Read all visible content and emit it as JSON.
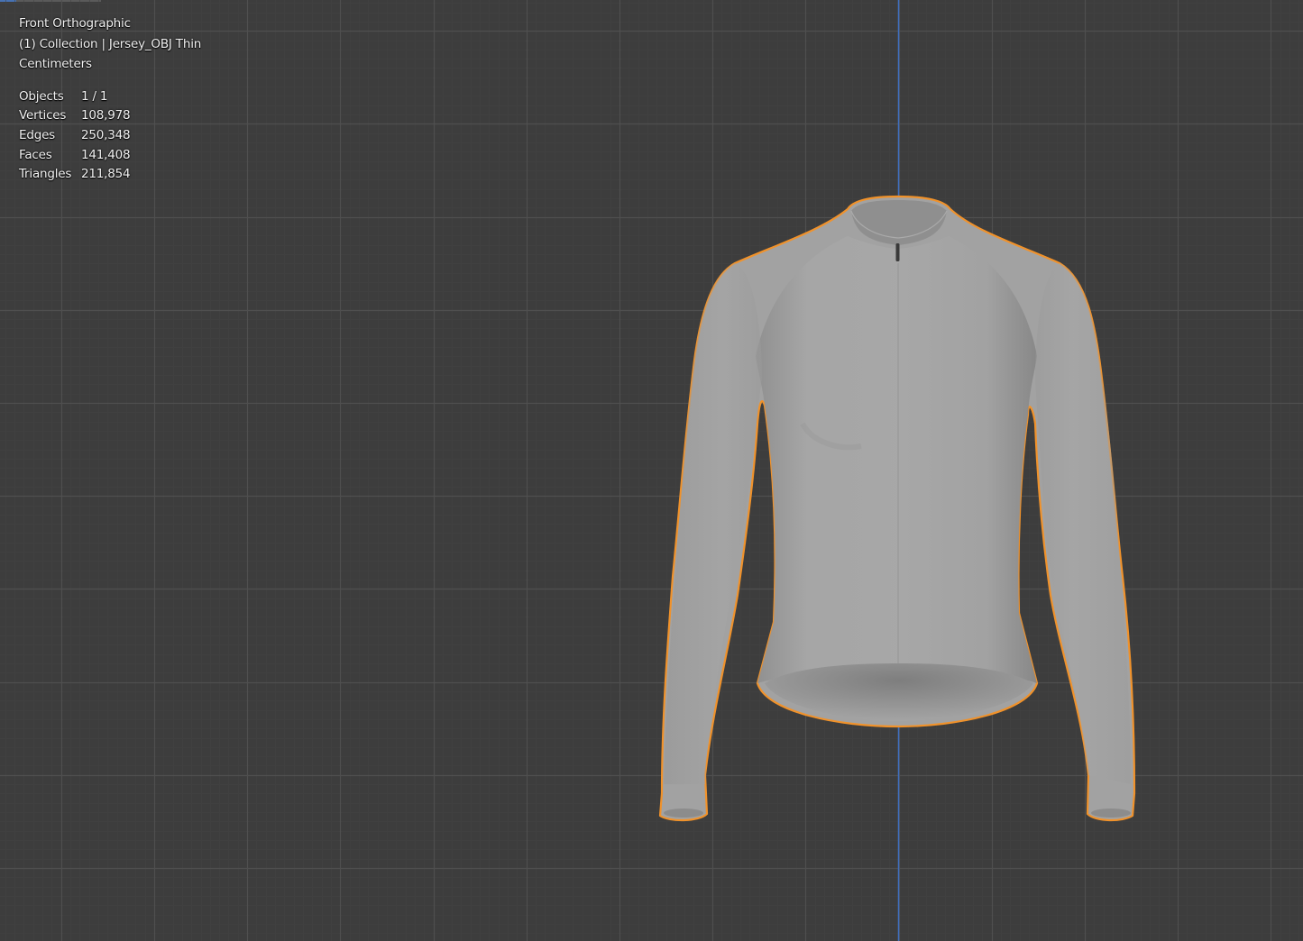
{
  "viewport": {
    "view_name": "Front Orthographic",
    "collection_line": "(1) Collection | Jersey_OBJ Thin",
    "units": "Centimeters",
    "stats": [
      {
        "label": "Objects",
        "value": "1 / 1"
      },
      {
        "label": "Vertices",
        "value": "108,978"
      },
      {
        "label": "Edges",
        "value": "250,348"
      },
      {
        "label": "Faces",
        "value": "141,408"
      },
      {
        "label": "Triangles",
        "value": "211,854"
      }
    ]
  },
  "colors": {
    "background": "#3d3d3d",
    "grid_minor": "#444444",
    "grid_major": "#4f4f4f",
    "z_axis": "#3f6fbf",
    "selection_outline": "#f0922b",
    "mesh_fill": "#a3a3a3"
  },
  "object": {
    "name": "Jersey_OBJ Thin",
    "selected": true
  }
}
